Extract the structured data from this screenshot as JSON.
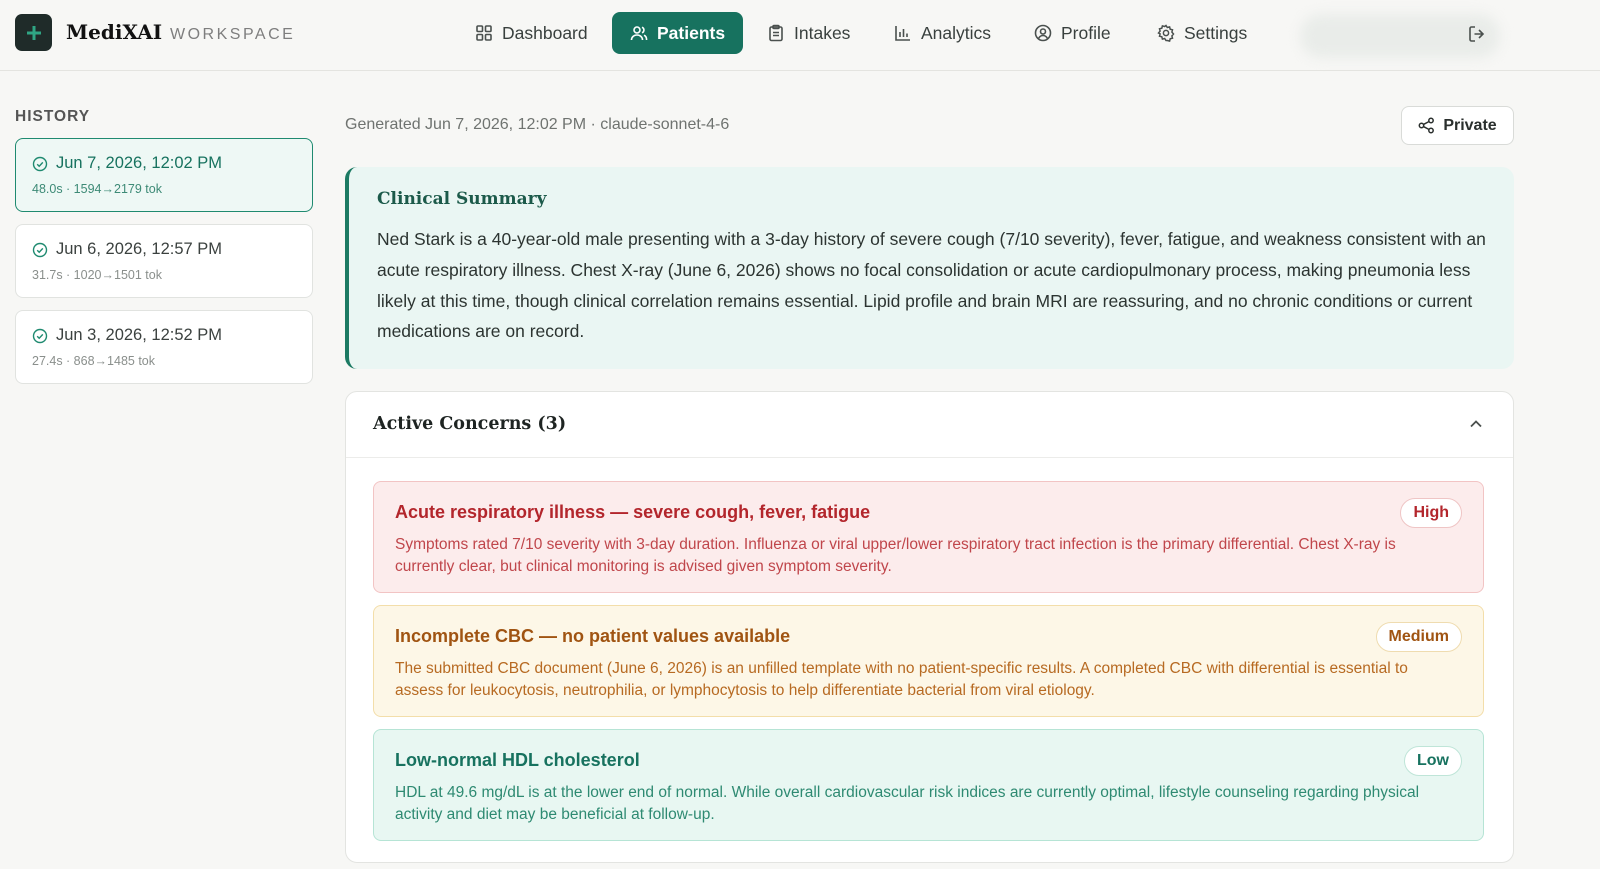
{
  "brand": {
    "name": "MediXAI",
    "subtitle": "WORKSPACE"
  },
  "nav": {
    "items": [
      {
        "label": "Dashboard",
        "icon": "grid-icon"
      },
      {
        "label": "Patients",
        "icon": "users-icon",
        "active": true
      },
      {
        "label": "Intakes",
        "icon": "clipboard-icon"
      },
      {
        "label": "Analytics",
        "icon": "bar-chart-icon"
      },
      {
        "label": "Profile",
        "icon": "user-circle-icon"
      },
      {
        "label": "Settings",
        "icon": "gear-icon"
      }
    ]
  },
  "history": {
    "title": "HISTORY",
    "items": [
      {
        "date": "Jun 7, 2026, 12:02 PM",
        "meta": "48.0s · 1594→2179 tok",
        "active": true
      },
      {
        "date": "Jun 6, 2026, 12:57 PM",
        "meta": "31.7s · 1020→1501 tok"
      },
      {
        "date": "Jun 3, 2026, 12:52 PM",
        "meta": "27.4s · 868→1485 tok"
      }
    ]
  },
  "main": {
    "generated": "Generated Jun 7, 2026, 12:02 PM · claude-sonnet-4-6",
    "private_label": "Private",
    "summary": {
      "title": "Clinical Summary",
      "text": "Ned Stark is a 40-year-old male presenting with a 3-day history of severe cough (7/10 severity), fever, fatigue, and weakness consistent with an acute respiratory illness. Chest X-ray (June 6, 2026) shows no focal consolidation or acute cardiopulmonary process, making pneumonia less likely at this time, though clinical correlation remains essential. Lipid profile and brain MRI are reassuring, and no chronic conditions or current medications are on record."
    },
    "concerns": {
      "title": "Active Concerns (3)",
      "items": [
        {
          "title": "Acute respiratory illness — severe cough, fever, fatigue",
          "badge": "High",
          "body": "Symptoms rated 7/10 severity with 3-day duration. Influenza or viral upper/lower respiratory tract infection is the primary differential. Chest X-ray is currently clear, but clinical monitoring is advised given symptom severity."
        },
        {
          "title": "Incomplete CBC — no patient values available",
          "badge": "Medium",
          "body": "The submitted CBC document (June 6, 2026) is an unfilled template with no patient-specific results. A completed CBC with differential is essential to assess for leukocytosis, neutrophilia, or lymphocytosis to help differentiate bacterial from viral etiology."
        },
        {
          "title": "Low-normal HDL cholesterol",
          "badge": "Low",
          "body": "HDL at 49.6 mg/dL is at the lower end of normal. While overall cardiovascular risk indices are currently optimal, lifestyle counseling regarding physical activity and diet may be beneficial at follow-up."
        }
      ]
    }
  },
  "colors": {
    "accent": "#17725f",
    "high": "#b3262c",
    "medium": "#a05412",
    "low": "#17725f"
  }
}
